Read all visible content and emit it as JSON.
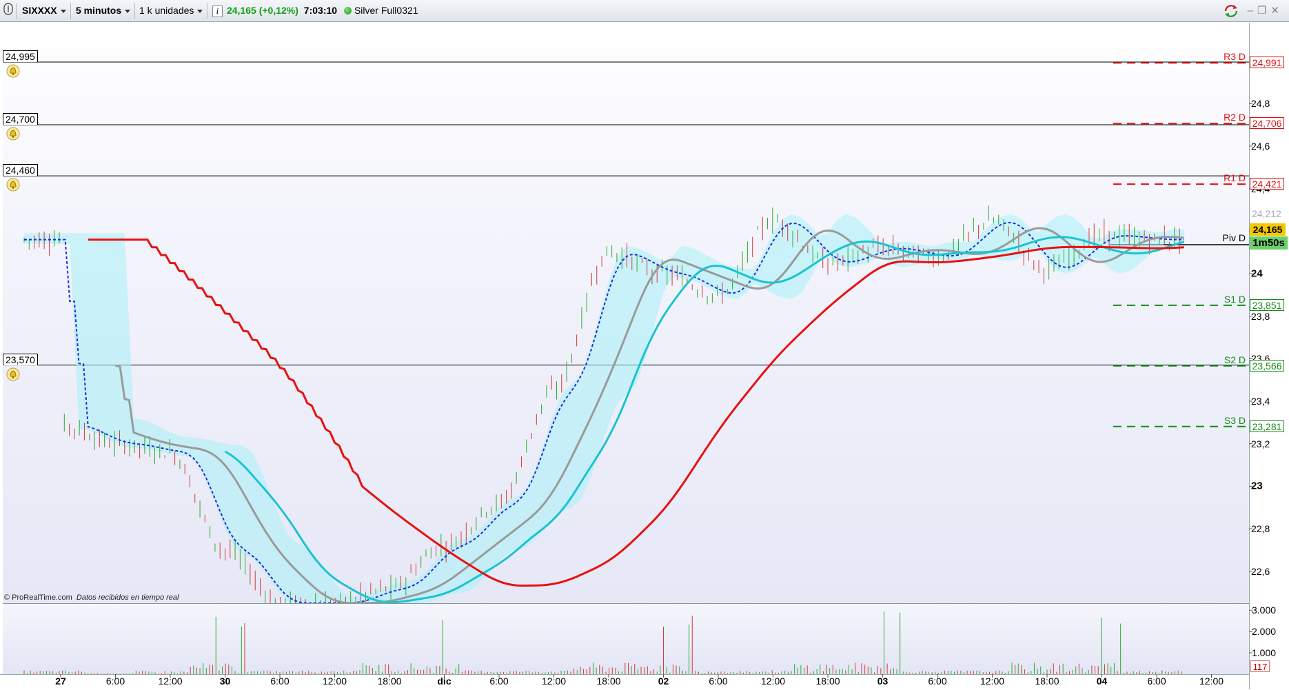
{
  "toolbar": {
    "symbol": "SIXXXX",
    "timeframe": "5 minutos",
    "units": "1 k unidades",
    "price": "24,165 (+0,12%)",
    "time": "7:03:10",
    "contract": "Silver Full0321",
    "icons": [
      "grid-icon",
      "info-icon",
      "status-dot-icon",
      "sync-icon",
      "minimize-icon",
      "restore-icon",
      "close-icon"
    ]
  },
  "price_axis": {
    "labels": [
      "24,8",
      "24,6",
      "24,4",
      "24,2",
      "24",
      "23,8",
      "23,6",
      "23,4",
      "23,2",
      "23",
      "22,8",
      "22,6"
    ],
    "bold_labels": [
      "24",
      "23"
    ],
    "current_price": "24,165",
    "timer": "1m50s",
    "ghost_price": "24,212"
  },
  "alert_lines": [
    {
      "label": "24,995",
      "value": 24.995
    },
    {
      "label": "24,700",
      "value": 24.7
    },
    {
      "label": "24,460",
      "value": 24.46
    },
    {
      "label": "23,570",
      "value": 23.57
    }
  ],
  "pivots": [
    {
      "name": "R3 D",
      "value_label": "24,991",
      "value": 24.991,
      "kind": "res"
    },
    {
      "name": "R2 D",
      "value_label": "24,706",
      "value": 24.706,
      "kind": "res"
    },
    {
      "name": "R1 D",
      "value_label": "24,421",
      "value": 24.421,
      "kind": "res"
    },
    {
      "name": "Piv D",
      "value_label": "",
      "value": 24.136,
      "kind": "piv"
    },
    {
      "name": "S1 D",
      "value_label": "23,851",
      "value": 23.851,
      "kind": "sup"
    },
    {
      "name": "S2 D",
      "value_label": "23,566",
      "value": 23.566,
      "kind": "sup"
    },
    {
      "name": "S3 D",
      "value_label": "23,281",
      "value": 23.281,
      "kind": "sup"
    }
  ],
  "time_axis": {
    "labels": [
      "27",
      "6:00",
      "12:00",
      "30",
      "6:00",
      "12:00",
      "18:00",
      "dic",
      "6:00",
      "12:00",
      "18:00",
      "02",
      "6:00",
      "12:00",
      "18:00",
      "03",
      "6:00",
      "12:00",
      "18:00",
      "04",
      "6:00",
      "12:00"
    ],
    "bold_labels": [
      "27",
      "30",
      "dic",
      "02",
      "03",
      "04"
    ]
  },
  "volume_axis": {
    "labels": [
      "3.000",
      "2.000",
      "1.000"
    ],
    "current": "117"
  },
  "copyright": {
    "brand": "© ProRealTime.com",
    "note": "Datos recibidos en tiempo real"
  },
  "colors": {
    "up": "#2eaa2e",
    "down": "#d23a3a",
    "ma_red": "#e81010",
    "ma_cyan": "#19c4d0",
    "ma_gray": "#9a9a9a",
    "dotted_blue": "#1a2ee0",
    "cloud": "#a8f0f8",
    "resistance": "#e01010",
    "support": "#1a8a1a"
  },
  "chart_data": {
    "type": "candlestick",
    "title": "",
    "y_range": [
      22.45,
      25.18
    ],
    "indicators": [
      "moving average (red)",
      "moving average (cyan)",
      "moving average (gray)",
      "dotted line (blue)",
      "cloud (light cyan)",
      "daily pivots",
      "volume"
    ],
    "path_points": [
      [
        "27",
        23.29
      ],
      [
        "6:00",
        23.2
      ],
      [
        "12:00",
        23.16
      ],
      [
        "30",
        22.7
      ],
      [
        "6:00",
        22.45
      ],
      [
        "12:00",
        22.45
      ],
      [
        "18:00",
        22.52
      ],
      [
        "dic",
        22.72
      ],
      [
        "6:00",
        22.92
      ],
      [
        "12:00",
        23.45
      ],
      [
        "18:00",
        24.1
      ],
      [
        "02",
        24.0
      ],
      [
        "6:00",
        23.9
      ],
      [
        "12:00",
        24.25
      ],
      [
        "18:00",
        24.05
      ],
      [
        "03",
        24.12
      ],
      [
        "6:00",
        24.08
      ],
      [
        "12:00",
        24.25
      ],
      [
        "18:00",
        24.02
      ],
      [
        "04",
        24.18
      ],
      [
        "6:00",
        24.16
      ]
    ]
  }
}
